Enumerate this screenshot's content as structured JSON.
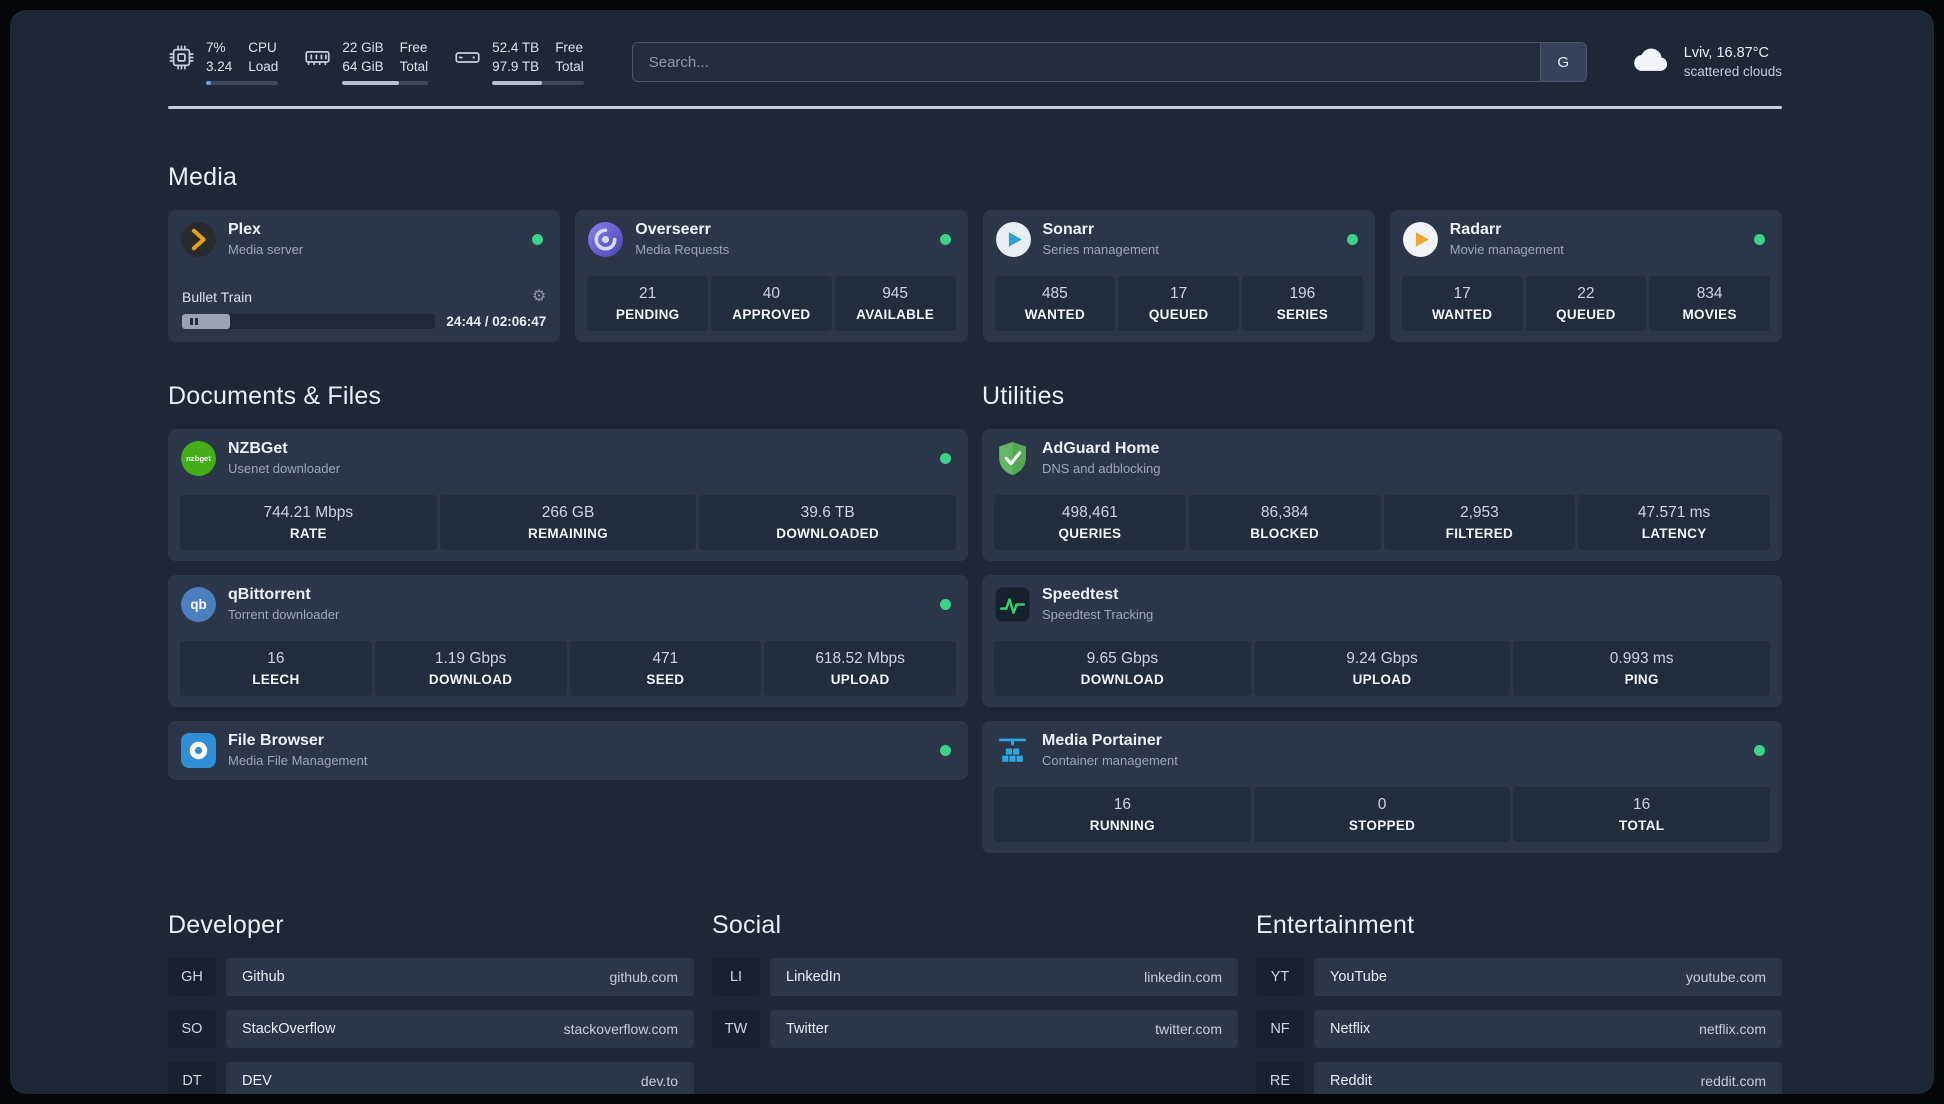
{
  "topbar": {
    "cpu": {
      "icon": "cpu-chip-icon",
      "percent": "7%",
      "value": "3.24",
      "label_top": "CPU",
      "label_bottom": "Load",
      "bar_percent": 7
    },
    "memory": {
      "icon": "ram-icon",
      "free": "22 GiB",
      "total": "64 GiB",
      "label_top": "Free",
      "label_bottom": "Total",
      "bar_percent": 66
    },
    "disk": {
      "icon": "hard-drive-icon",
      "free": "52.4 TB",
      "total": "97.9 TB",
      "label_top": "Free",
      "label_bottom": "Total",
      "bar_percent": 54
    },
    "search": {
      "placeholder": "Search...",
      "engine_label": "G"
    },
    "weather": {
      "icon": "cloud-icon",
      "location": "Lviv, 16.87°C",
      "condition": "scattered clouds"
    }
  },
  "icons": {
    "gear": "⚙"
  },
  "sections": {
    "media": {
      "title": "Media",
      "apps": [
        {
          "icon": "plex-icon",
          "name": "Plex",
          "desc": "Media server",
          "status": "online",
          "player": {
            "track": "Bullet Train",
            "time": "24:44 / 02:06:47",
            "progress_percent": 19
          }
        },
        {
          "icon": "overseerr-icon",
          "name": "Overseerr",
          "desc": "Media Requests",
          "status": "online",
          "stats": [
            {
              "value": "21",
              "label": "PENDING"
            },
            {
              "value": "40",
              "label": "APPROVED"
            },
            {
              "value": "945",
              "label": "AVAILABLE"
            }
          ]
        },
        {
          "icon": "sonarr-icon",
          "name": "Sonarr",
          "desc": "Series management",
          "status": "online",
          "stats": [
            {
              "value": "485",
              "label": "WANTED"
            },
            {
              "value": "17",
              "label": "QUEUED"
            },
            {
              "value": "196",
              "label": "SERIES"
            }
          ]
        },
        {
          "icon": "radarr-icon",
          "name": "Radarr",
          "desc": "Movie management",
          "status": "online",
          "stats": [
            {
              "value": "17",
              "label": "WANTED"
            },
            {
              "value": "22",
              "label": "QUEUED"
            },
            {
              "value": "834",
              "label": "MOVIES"
            }
          ]
        }
      ]
    },
    "documents": {
      "title": "Documents & Files",
      "apps": [
        {
          "icon": "nzbget-icon",
          "name": "NZBGet",
          "desc": "Usenet downloader",
          "status": "online",
          "stats": [
            {
              "value": "744.21 Mbps",
              "label": "RATE"
            },
            {
              "value": "266 GB",
              "label": "REMAINING"
            },
            {
              "value": "39.6 TB",
              "label": "DOWNLOADED"
            }
          ]
        },
        {
          "icon": "qbittorrent-icon",
          "name": "qBittorrent",
          "desc": "Torrent downloader",
          "status": "online",
          "stats": [
            {
              "value": "16",
              "label": "LEECH"
            },
            {
              "value": "1.19 Gbps",
              "label": "DOWNLOAD"
            },
            {
              "value": "471",
              "label": "SEED"
            },
            {
              "value": "618.52 Mbps",
              "label": "UPLOAD"
            }
          ]
        },
        {
          "icon": "filebrowser-icon",
          "name": "File Browser",
          "desc": "Media File Management",
          "status": "online",
          "stats": []
        }
      ]
    },
    "utilities": {
      "title": "Utilities",
      "apps": [
        {
          "icon": "adguard-icon",
          "name": "AdGuard Home",
          "desc": "DNS and adblocking",
          "stats": [
            {
              "value": "498,461",
              "label": "QUERIES"
            },
            {
              "value": "86,384",
              "label": "BLOCKED"
            },
            {
              "value": "2,953",
              "label": "FILTERED"
            },
            {
              "value": "47.571 ms",
              "label": "LATENCY"
            }
          ]
        },
        {
          "icon": "speedtest-icon",
          "name": "Speedtest",
          "desc": "Speedtest Tracking",
          "stats": [
            {
              "value": "9.65 Gbps",
              "label": "DOWNLOAD"
            },
            {
              "value": "9.24 Gbps",
              "label": "UPLOAD"
            },
            {
              "value": "0.993 ms",
              "label": "PING"
            }
          ]
        },
        {
          "icon": "portainer-icon",
          "name": "Media Portainer",
          "desc": "Container management",
          "status": "online",
          "stats": [
            {
              "value": "16",
              "label": "RUNNING"
            },
            {
              "value": "0",
              "label": "STOPPED"
            },
            {
              "value": "16",
              "label": "TOTAL"
            }
          ]
        }
      ]
    }
  },
  "bookmarks": {
    "developer": {
      "title": "Developer",
      "items": [
        {
          "abbr": "GH",
          "name": "Github",
          "url": "github.com"
        },
        {
          "abbr": "SO",
          "name": "StackOverflow",
          "url": "stackoverflow.com"
        },
        {
          "abbr": "DT",
          "name": "DEV",
          "url": "dev.to"
        }
      ]
    },
    "social": {
      "title": "Social",
      "items": [
        {
          "abbr": "LI",
          "name": "LinkedIn",
          "url": "linkedin.com"
        },
        {
          "abbr": "TW",
          "name": "Twitter",
          "url": "twitter.com"
        }
      ]
    },
    "entertainment": {
      "title": "Entertainment",
      "items": [
        {
          "abbr": "YT",
          "name": "YouTube",
          "url": "youtube.com"
        },
        {
          "abbr": "NF",
          "name": "Netflix",
          "url": "netflix.com"
        },
        {
          "abbr": "RE",
          "name": "Reddit",
          "url": "reddit.com"
        }
      ]
    }
  },
  "colors": {
    "background": "#1d2735",
    "card": "#2b3649",
    "tile": "#212c3d",
    "status_online": "#3bd389",
    "text_primary": "#eef2f8",
    "text_secondary": "#9ca7b9"
  }
}
